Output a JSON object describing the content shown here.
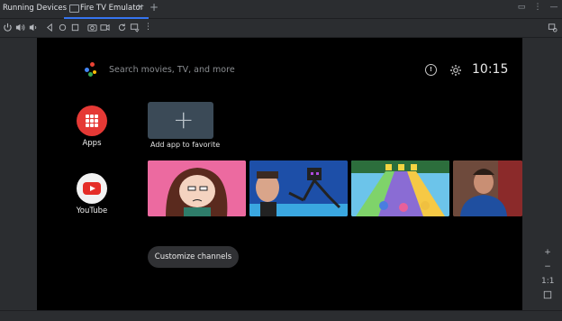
{
  "header": {
    "panel_title": "Running Devices",
    "tab_label": "Fire TV Emulator",
    "tab_close": "×",
    "tab_add": "+"
  },
  "window_icons": [
    "layout-icon",
    "more-vertical-icon",
    "minimize-icon"
  ],
  "toolbar_icons": [
    "power-icon",
    "volume-up-icon",
    "volume-down-icon",
    "back-icon",
    "home-icon",
    "overview-icon",
    "screenshot-icon",
    "record-icon",
    "rotate-icon",
    "snapshot-icon",
    "more-icon"
  ],
  "tv": {
    "search_placeholder": "Search movies, TV, and more",
    "info_glyph": "!",
    "clock": "10:15",
    "apps_label": "Apps",
    "youtube_label": "YouTube",
    "add_app_label": "Add app to favorite",
    "customize_label": "Customize channels"
  },
  "zoom": {
    "plus": "+",
    "minus": "−",
    "ratio": "1:1"
  },
  "colors": {
    "accent": "#3574f0",
    "tv_background": "#000000",
    "apps_red": "#e53935",
    "youtube_red": "#e52d27"
  }
}
